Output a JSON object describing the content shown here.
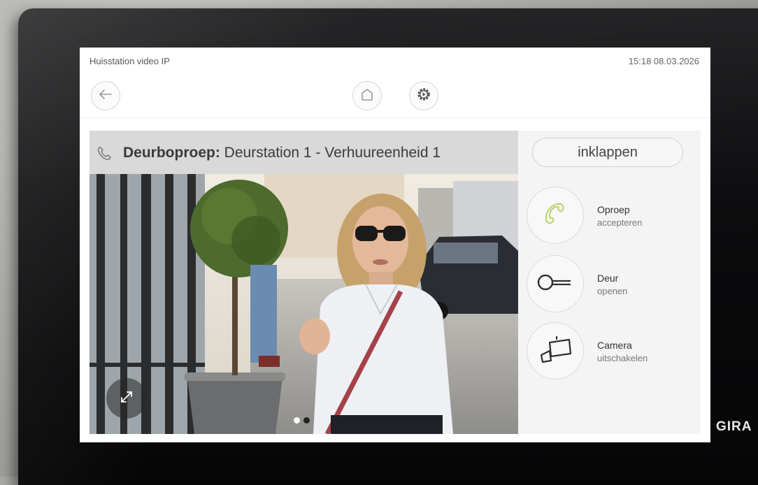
{
  "status_bar": {
    "app_title": "Huisstation video IP",
    "datetime": "15:18 08.03.2026"
  },
  "toolbar": {
    "back_icon": "arrow-left-icon",
    "home_icon": "home-icon",
    "settings_icon": "gear-icon"
  },
  "call": {
    "label_bold": "Deurboproep:",
    "label_rest": "Deurstation 1 - Verhuureenheid 1",
    "icon": "phone-icon",
    "pager_total": 2,
    "pager_active": 1
  },
  "side_panel": {
    "collapse_label": "inklappen",
    "actions": [
      {
        "line1": "Oproep",
        "line2": "accepteren",
        "icon": "phone-icon",
        "color": "#b7d36a"
      },
      {
        "line1": "Deur",
        "line2": "openen",
        "icon": "key-icon"
      },
      {
        "line1": "Camera",
        "line2": "uitschakelen",
        "icon": "camera-off-icon"
      }
    ]
  },
  "device": {
    "brand": "GIRA"
  }
}
